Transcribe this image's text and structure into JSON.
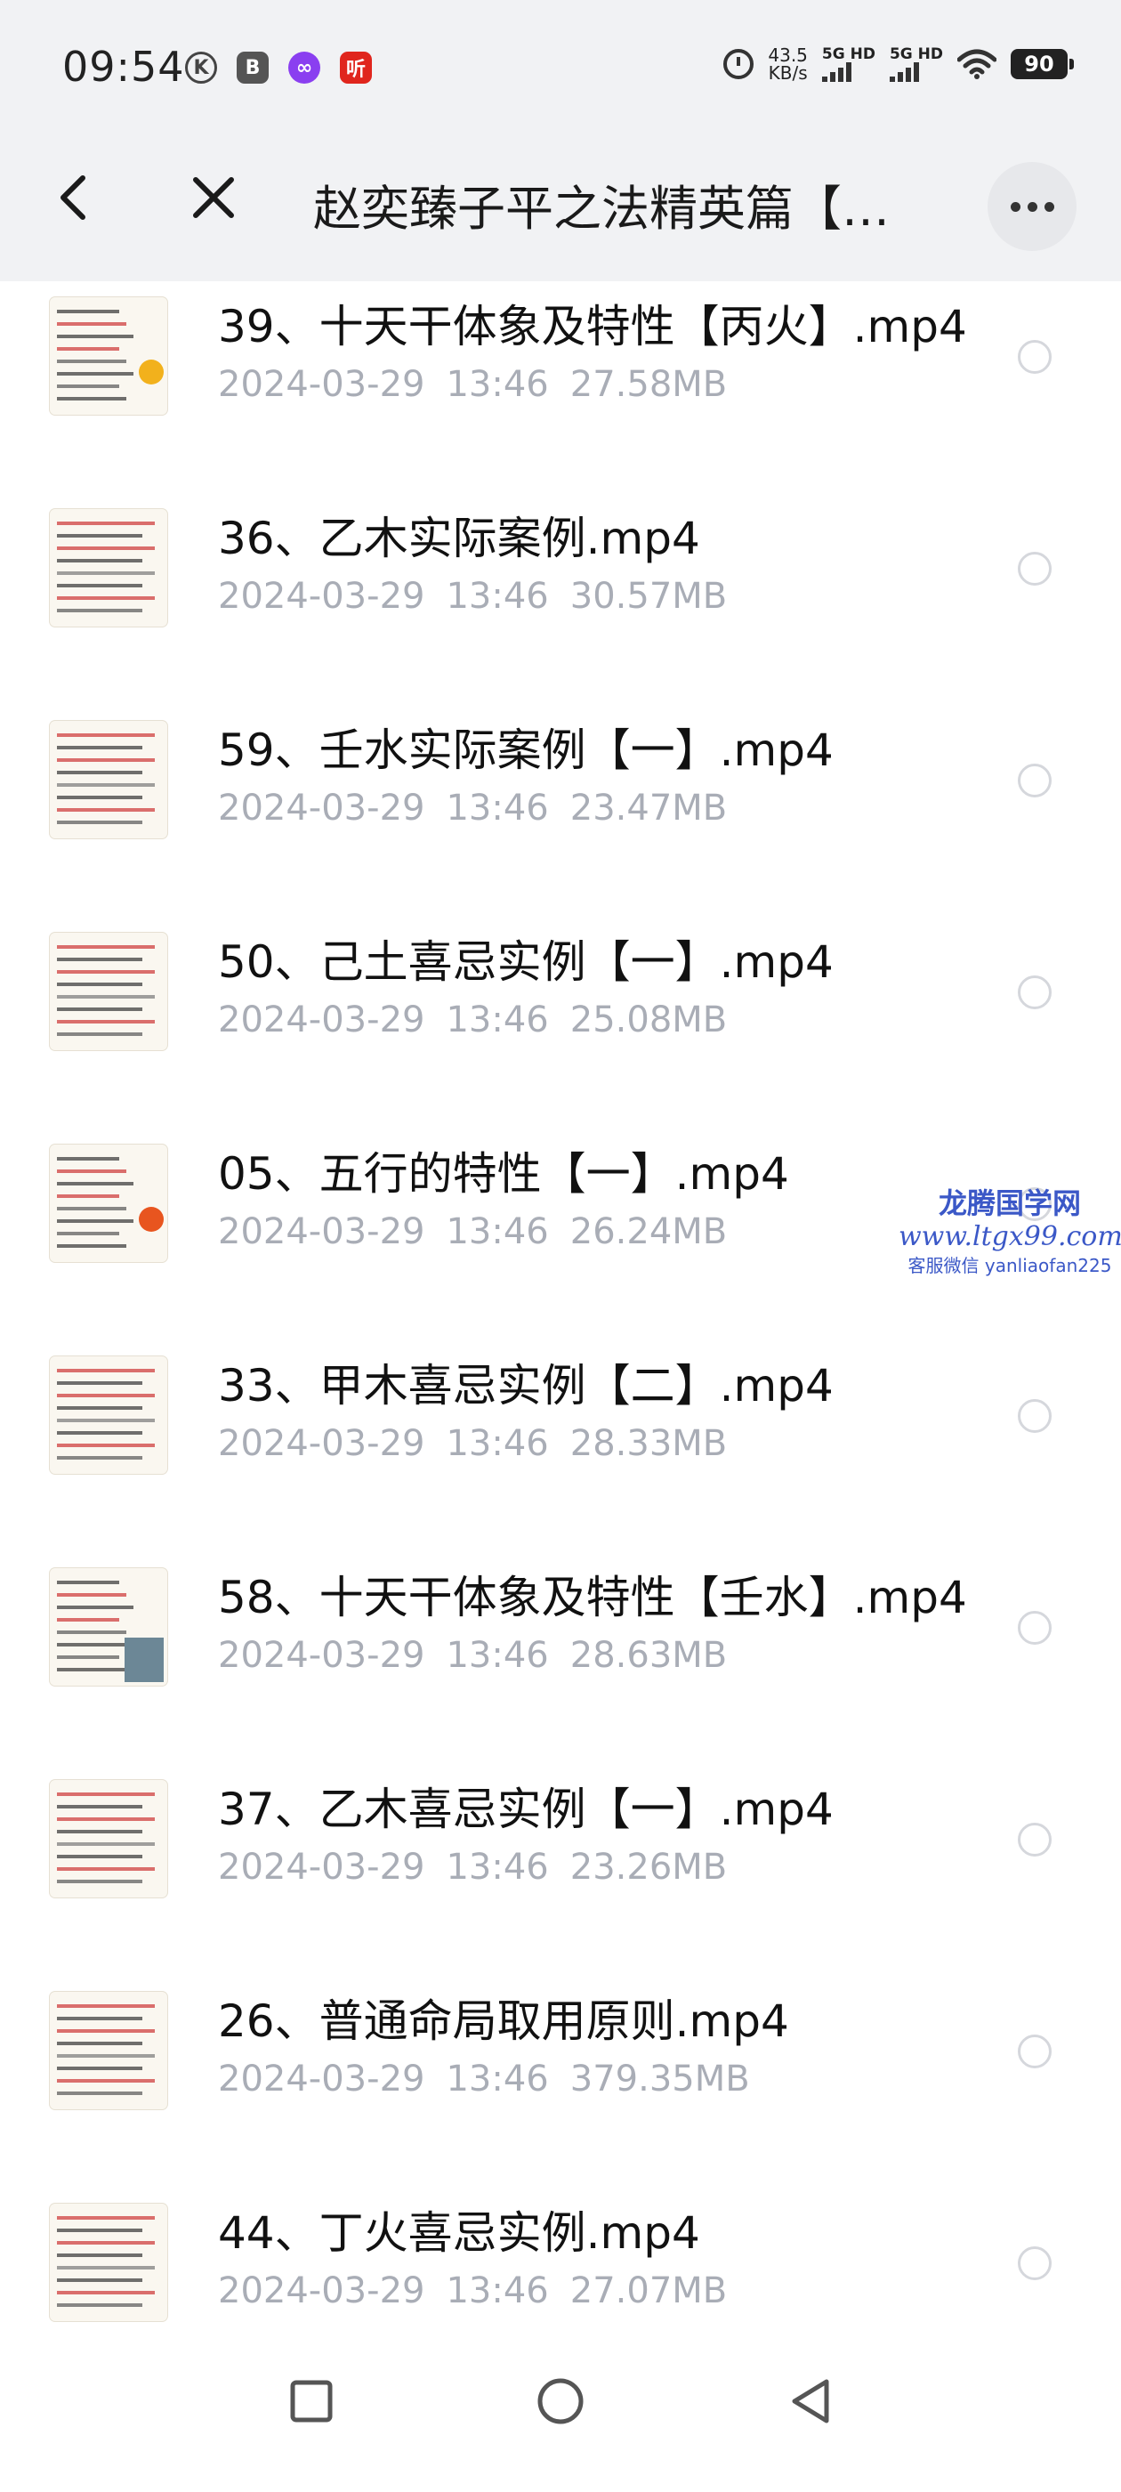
{
  "status_bar": {
    "time": "09:54",
    "app_icons": [
      {
        "icon": "k-icon",
        "glyph": "K"
      },
      {
        "icon": "b-app-icon",
        "glyph": "B"
      },
      {
        "icon": "loop-app-icon",
        "glyph": "∞"
      },
      {
        "icon": "listen-app-icon",
        "glyph": "听"
      }
    ],
    "net_speed_value": "43.5",
    "net_speed_unit": "KB/s",
    "signal_1_label": "5G HD",
    "signal_2_label": "5G HD",
    "battery": "90"
  },
  "header": {
    "title": "赵奕臻子平之法精英篇【…"
  },
  "files": [
    {
      "name": "39、十天干体象及特性【丙火】.mp4",
      "date": "2024-03-29",
      "time": "13:46",
      "size": "27.58MB",
      "thumb": "text-sun"
    },
    {
      "name": "36、乙木实际案例.mp4",
      "date": "2024-03-29",
      "time": "13:46",
      "size": "30.57MB",
      "thumb": "chart"
    },
    {
      "name": "59、壬水实际案例【一】.mp4",
      "date": "2024-03-29",
      "time": "13:46",
      "size": "23.47MB",
      "thumb": "chart"
    },
    {
      "name": "50、己土喜忌实例【一】.mp4",
      "date": "2024-03-29",
      "time": "13:46",
      "size": "25.08MB",
      "thumb": "chart"
    },
    {
      "name": "05、五行的特性【一】.mp4",
      "date": "2024-03-29",
      "time": "13:46",
      "size": "26.24MB",
      "thumb": "text-fire"
    },
    {
      "name": "33、甲木喜忌实例【二】.mp4",
      "date": "2024-03-29",
      "time": "13:46",
      "size": "28.33MB",
      "thumb": "chart"
    },
    {
      "name": "58、十天干体象及特性【壬水】.mp4",
      "date": "2024-03-29",
      "time": "13:46",
      "size": "28.63MB",
      "thumb": "text-water"
    },
    {
      "name": "37、乙木喜忌实例【一】.mp4",
      "date": "2024-03-29",
      "time": "13:46",
      "size": "23.26MB",
      "thumb": "chart"
    },
    {
      "name": "26、普通命局取用原则.mp4",
      "date": "2024-03-29",
      "time": "13:46",
      "size": "379.35MB",
      "thumb": "chart"
    },
    {
      "name": "44、丁火喜忌实例.mp4",
      "date": "2024-03-29",
      "time": "13:46",
      "size": "27.07MB",
      "thumb": "chart"
    }
  ],
  "watermark": {
    "name": "龙腾国学网",
    "url": "www.ltgx99.com",
    "contact": "客服微信 yanliaofan225"
  },
  "colors": {
    "header_bg": "#f1f2f4",
    "title": "#1a1a1a",
    "file_name": "#111111",
    "file_meta": "#a9adb6",
    "radio_border": "#d5d7dc",
    "watermark": "#3b58c7"
  },
  "nav": {
    "recents_icon": "square-icon",
    "home_icon": "circle-icon",
    "back_icon": "triangle-back-icon"
  }
}
